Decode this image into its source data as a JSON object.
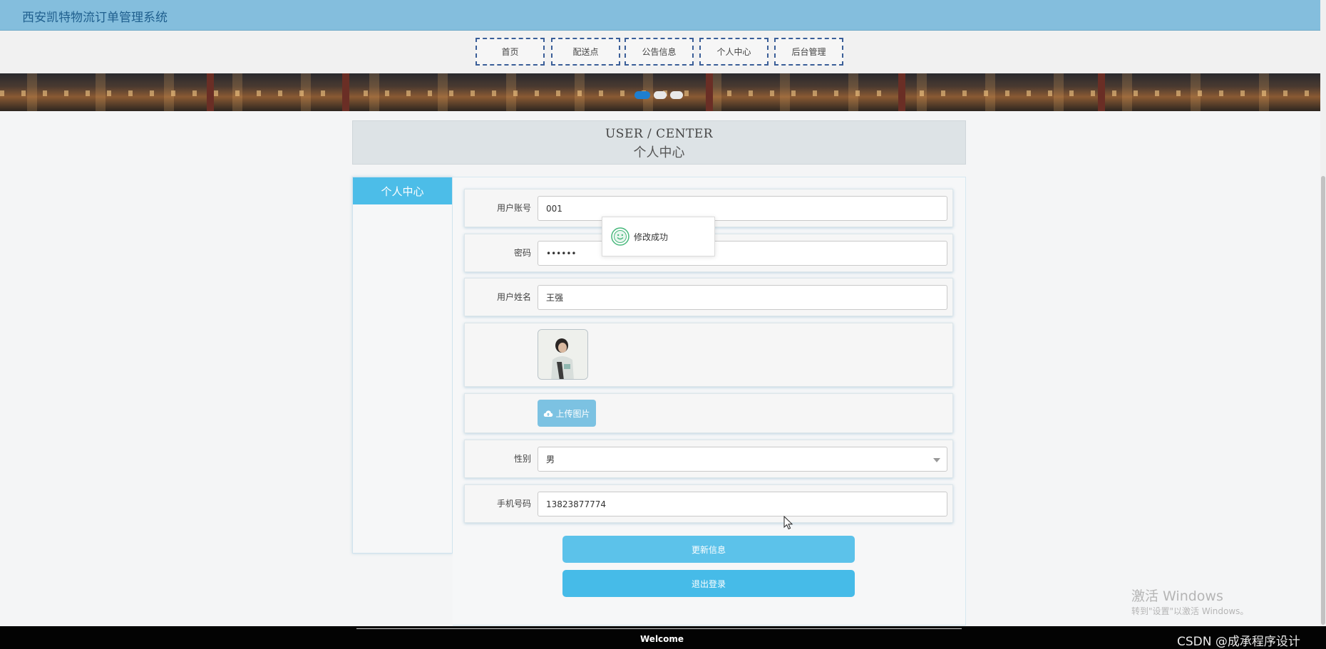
{
  "app": {
    "title": "西安凯特物流订单管理系统"
  },
  "nav": {
    "items": [
      "首页",
      "配送点",
      "公告信息",
      "个人中心",
      "后台管理"
    ]
  },
  "carousel": {
    "slide_count": 3,
    "active_index": 0
  },
  "page_header": {
    "en": "USER / CENTER",
    "cn": "个人中心"
  },
  "sidebar": {
    "items": [
      {
        "label": "个人中心",
        "active": true
      }
    ]
  },
  "form": {
    "account": {
      "label": "用户账号",
      "value": "001"
    },
    "password": {
      "label": "密码",
      "value": "••••••"
    },
    "name": {
      "label": "用户姓名",
      "value": "王强"
    },
    "avatar": {
      "icon": "user-photo"
    },
    "upload": {
      "label": "上传图片",
      "icon": "cloud-upload-icon"
    },
    "gender": {
      "label": "性别",
      "value": "男"
    },
    "phone": {
      "label": "手机号码",
      "value": "13823877774"
    }
  },
  "buttons": {
    "update": "更新信息",
    "logout": "退出登录"
  },
  "toast": {
    "text": "修改成功",
    "icon": "smiley-icon"
  },
  "watermark": {
    "line1": "激活 Windows",
    "line2": "转到\"设置\"以激活 Windows。"
  },
  "footer": {
    "welcome": "Welcome",
    "csdn": "CSDN @成承程序设计"
  },
  "colors": {
    "accent": "#4cbde8",
    "topbar": "#84bedd",
    "nav_border": "#3a5e98"
  }
}
